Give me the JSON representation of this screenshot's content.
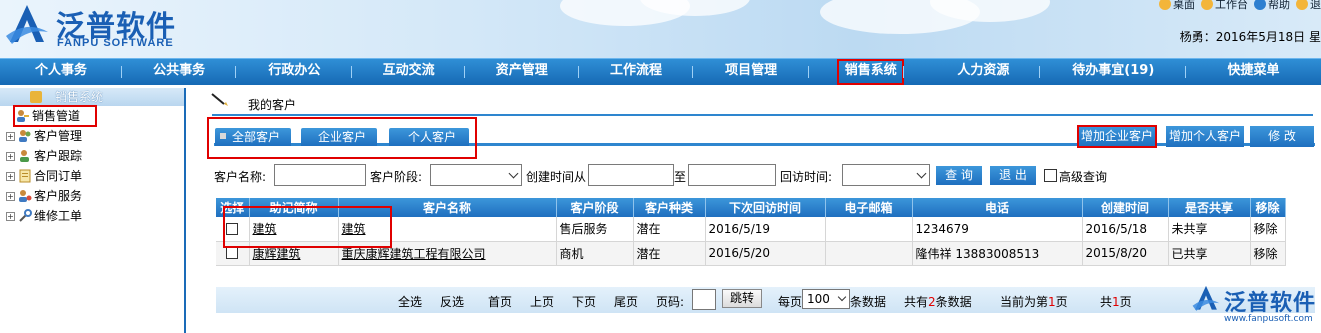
{
  "header": {
    "logo_cn": "泛普软件",
    "logo_en": "FANPU SOFTWARE",
    "top_links": [
      "桌面",
      "工作台",
      "帮助",
      "退"
    ],
    "date_text": "杨勇：2016年5月18日 星"
  },
  "nav": {
    "items": [
      "个人事务",
      "公共事务",
      "行政办公",
      "互动交流",
      "资产管理",
      "工作流程",
      "项目管理",
      "销售系统",
      "人力资源",
      "待办事宜(19)",
      "快捷菜单"
    ],
    "active": "销售系统"
  },
  "sidebar": {
    "title": "销售系统",
    "items": [
      "销售管道",
      "客户管理",
      "客户跟踪",
      "合同订单",
      "客户服务",
      "维修工单"
    ]
  },
  "breadcrumb": "我的客户",
  "tabs": [
    "全部客户",
    "企业客户",
    "个人客户"
  ],
  "actions": {
    "add_company": "增加企业客户",
    "add_person": "增加个人客户",
    "edit": "修 改"
  },
  "search": {
    "name_label": "客户名称:",
    "stage_label": "客户阶段:",
    "created_from_label": "创建时间从",
    "to_label": "至",
    "visit_label": "回访时间:",
    "query_button": "查 询",
    "exit_button": "退 出",
    "advanced_label": "高级查询"
  },
  "table": {
    "headers": [
      "选择",
      "助记简称",
      "客户名称",
      "客户阶段",
      "客户种类",
      "下次回访时间",
      "电子邮箱",
      "电话",
      "创建时间",
      "是否共享",
      "移除"
    ],
    "rows": [
      {
        "short": "建筑",
        "name": "建筑",
        "stage": "售后服务",
        "kind": "潜在",
        "next_visit": "2016/5/19",
        "email": "",
        "phone": "1234679",
        "created": "2016/5/18",
        "shared": "未共享",
        "remove": "移除"
      },
      {
        "short": "康辉建筑",
        "name": "重庆康辉建筑工程有限公司",
        "stage": "商机",
        "kind": "潜在",
        "next_visit": "2016/5/20",
        "email": "",
        "phone": "隆伟祥  13883008513",
        "created": "2015/8/20",
        "shared": "已共享",
        "remove": "移除"
      }
    ]
  },
  "pager": {
    "select_all": "全选",
    "invert": "反选",
    "first": "首页",
    "prev": "上页",
    "next": "下页",
    "last": "尾页",
    "page_label": "页码:",
    "jump": "跳转",
    "per_page_label": "每页",
    "per_page_value": "100",
    "records_label": "条数据",
    "total_prefix": "共有",
    "total_count": "2",
    "total_suffix": "条数据",
    "current_prefix": "当前为第",
    "current_page": "1",
    "current_suffix": "页",
    "pages_prefix": "共",
    "pages_count": "1",
    "pages_suffix": "页"
  },
  "watermark": {
    "cn": "泛普软件",
    "url": "www.fanpusoft.com"
  },
  "colors": {
    "brand_blue": "#1a5fb4",
    "nav_blue": "#1669b4",
    "highlight_red": "#e00000"
  }
}
